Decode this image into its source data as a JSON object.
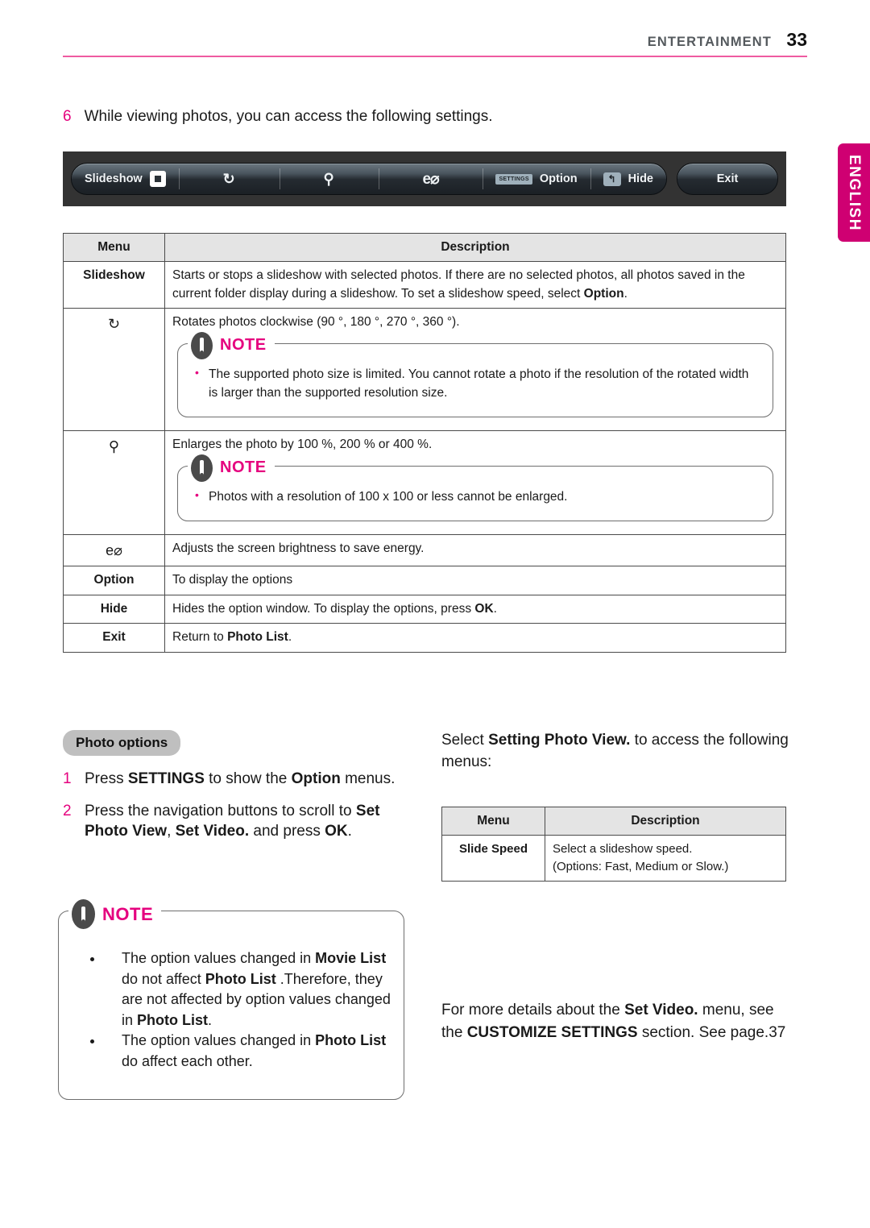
{
  "header": {
    "section": "ENTERTAINMENT",
    "page_number": "33",
    "rule_color": "#ef5ba1"
  },
  "language_tab": {
    "label": "ENGLISH",
    "color": "#cf0072"
  },
  "step_intro": {
    "number": "6",
    "text": "While viewing photos, you can access the following settings."
  },
  "osd_toolbar": {
    "buttons": [
      {
        "label": "Slideshow",
        "icon": "stop-square-icon"
      },
      {
        "label": "",
        "icon": "rotate-clockwise-icon",
        "glyph": "↻"
      },
      {
        "label": "",
        "icon": "magnifier-zoom-icon",
        "glyph": "⚲"
      },
      {
        "label": "",
        "icon": "energy-saving-icon",
        "glyph": "e⌀"
      },
      {
        "label": "Option",
        "icon": "settings-badge-icon",
        "badge": "SETTINGS"
      },
      {
        "label": "Hide",
        "icon": "back-arrow-badge-icon",
        "badge": "↰"
      }
    ],
    "exit_label": "Exit"
  },
  "main_table": {
    "headers": {
      "menu": "Menu",
      "description": "Description"
    },
    "rows": [
      {
        "menu": "Slideshow",
        "menu_is_icon": false,
        "description_html": "Starts or stops a slideshow with selected photos. If there are no selected photos, all photos saved in the current folder display during a slideshow. To set a slideshow speed, select <b>Option</b>."
      },
      {
        "menu": "↻",
        "menu_is_icon": true,
        "menu_icon_name": "rotate-clockwise-icon",
        "description_html": "Rotates photos clockwise (90 °, 180 °, 270 °, 360 °).",
        "note": {
          "title": "NOTE",
          "items": [
            "The supported photo size is limited. You cannot rotate a photo if the resolution of the rotated width is larger than the supported resolution size."
          ]
        }
      },
      {
        "menu": "⚲",
        "menu_is_icon": true,
        "menu_icon_name": "magnifier-zoom-icon",
        "description_html": "Enlarges the photo by 100 %, 200 % or 400 %.",
        "note": {
          "title": "NOTE",
          "items": [
            "Photos with a resolution of 100 x 100 or less cannot be enlarged."
          ]
        }
      },
      {
        "menu": "e⌀",
        "menu_is_icon": true,
        "menu_icon_name": "energy-saving-icon",
        "description_html": "Adjusts the screen brightness to save energy."
      },
      {
        "menu": "Option",
        "menu_is_icon": false,
        "description_html": "To display the options"
      },
      {
        "menu": "Hide",
        "menu_is_icon": false,
        "description_html": "Hides the option window. To display the options, press <b>OK</b>."
      },
      {
        "menu": "Exit",
        "menu_is_icon": false,
        "description_html": "Return to <b>Photo List</b>."
      }
    ]
  },
  "photo_options": {
    "heading": "Photo options",
    "steps": [
      {
        "number": "1",
        "text_html": "Press <b>SETTINGS</b> to show the <b>Option</b> menus."
      },
      {
        "number": "2",
        "text_html": "Press the navigation buttons to scroll to <b>Set Photo View</b>, <b>Set Video.</b> and press <b>OK</b>."
      }
    ],
    "note": {
      "title": "NOTE",
      "items_html": [
        "The option values changed in <b>Movie List</b> do not affect <b>Photo List</b> .Therefore, they are not affected by option values changed in <b>Photo List</b>.",
        "The option values changed in <b>Photo List</b> do affect each other."
      ]
    }
  },
  "right_column": {
    "intro_html": "Select <b>Setting Photo View.</b> to access the following menus:",
    "table": {
      "headers": {
        "menu": "Menu",
        "description": "Description"
      },
      "rows": [
        {
          "menu": "Slide Speed",
          "description_lines": [
            "Select a slideshow speed.",
            "(Options: Fast, Medium or Slow.)"
          ]
        }
      ]
    },
    "footer_html": "For more details about the <b>Set Video.</b> menu, see the <b>CUSTOMIZE SETTINGS</b> section. See page.37"
  }
}
